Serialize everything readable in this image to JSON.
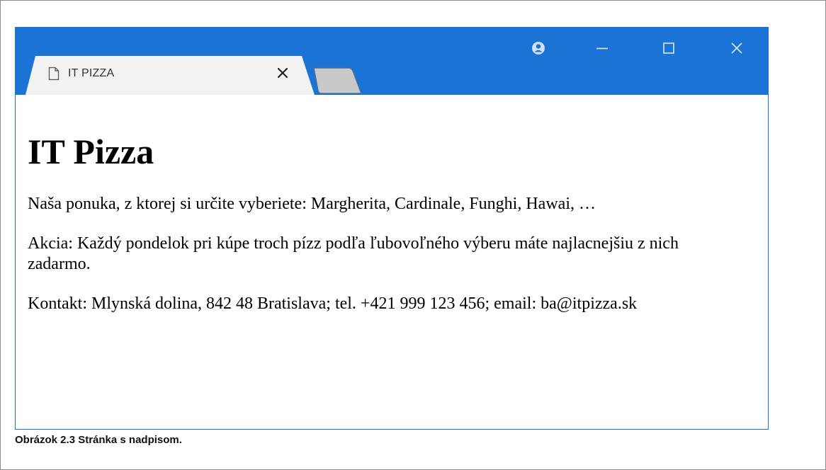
{
  "browser": {
    "tab_title": "IT PIZZA",
    "titlebar_color": "#1a73d5",
    "icons": {
      "tab": "document-icon",
      "tab_close": "close-icon",
      "profile": "profile-icon",
      "minimize": "minimize-icon",
      "maximize": "maximize-icon",
      "close": "close-icon"
    }
  },
  "page": {
    "heading": "IT Pizza",
    "paragraphs": [
      "Naša ponuka, z ktorej si určite vyberiete: Margherita, Cardinale, Funghi, Hawai, …",
      "Akcia: Každý pondelok pri kúpe troch pízz podľa ľubovoľného výberu máte najlacnejšiu z nich zadarmo.",
      "Kontakt: Mlynská dolina, 842 48 Bratislava; tel. +421 999 123 456; email: ba@itpizza.sk"
    ]
  },
  "caption": "Obrázok 2.3 Stránka s nadpisom."
}
